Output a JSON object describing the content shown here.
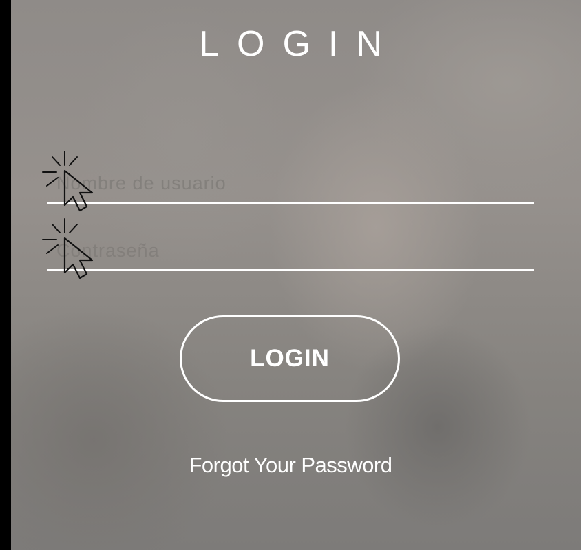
{
  "page": {
    "title": "LOGIN"
  },
  "form": {
    "username_placeholder": "Nombre de usuario",
    "username_value": "",
    "password_placeholder": "Contraseña",
    "password_value": "",
    "login_button_label": "LOGIN",
    "forgot_link_label": "Forgot Your Password"
  },
  "icons": {
    "username_field_icon": "click-cursor-icon",
    "password_field_icon": "click-cursor-icon"
  },
  "colors": {
    "text": "#ffffff",
    "placeholder": "#807c79",
    "outer_background": "#000000"
  }
}
